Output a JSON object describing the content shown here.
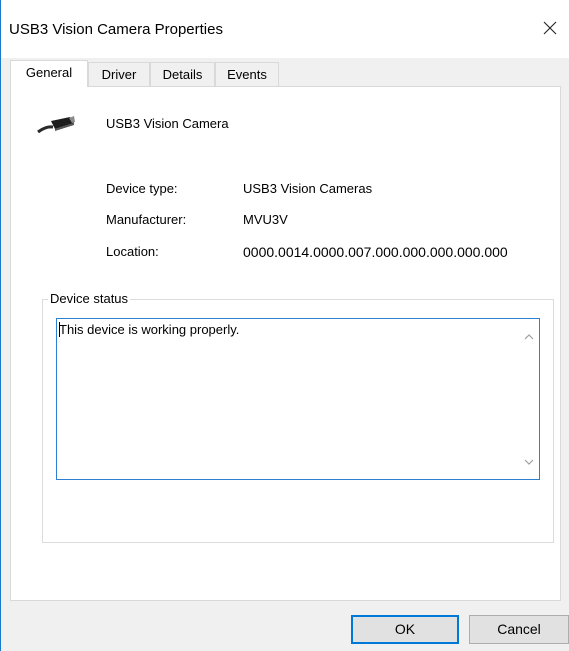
{
  "window": {
    "title": "USB3 Vision Camera Properties"
  },
  "tabs": [
    {
      "label": "General",
      "active": true
    },
    {
      "label": "Driver",
      "active": false
    },
    {
      "label": "Details",
      "active": false
    },
    {
      "label": "Events",
      "active": false
    }
  ],
  "device": {
    "name": "USB3 Vision Camera",
    "icon": "usb-cable-icon",
    "properties": [
      {
        "label": "Device type:",
        "value": "USB3 Vision Cameras"
      },
      {
        "label": "Manufacturer:",
        "value": "MVU3V"
      },
      {
        "label": "Location:",
        "value": "0000.0014.0000.007.000.000.000.000.000"
      }
    ]
  },
  "status": {
    "legend": "Device status",
    "text": "This device is working properly."
  },
  "buttons": {
    "ok": "OK",
    "cancel": "Cancel"
  },
  "colors": {
    "accent": "#0078d7",
    "window_bg": "#f0f0f0",
    "panel_bg": "#ffffff"
  }
}
